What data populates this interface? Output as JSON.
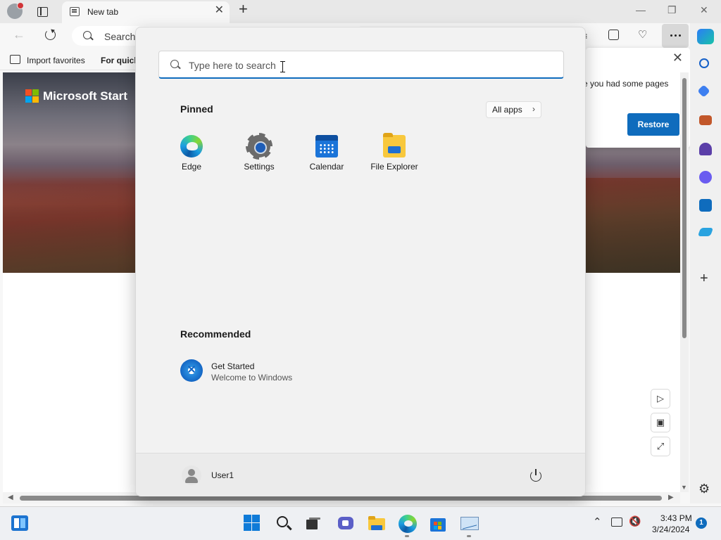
{
  "browser": {
    "tab_title": "New tab",
    "address_placeholder": "Search",
    "favorites": {
      "import_label": "Import favorites",
      "quick_label": "For quick"
    },
    "restore_prompt": {
      "text": "e you had some pages",
      "button_label": "Restore"
    },
    "brand": "Microsoft Start"
  },
  "start_menu": {
    "search_placeholder": "Type here to search",
    "pinned_title": "Pinned",
    "all_apps_label": "All apps",
    "pinned_apps": [
      {
        "label": "Edge",
        "icon": "edge-icon"
      },
      {
        "label": "Settings",
        "icon": "gear-icon"
      },
      {
        "label": "Calendar",
        "icon": "calendar-icon"
      },
      {
        "label": "File Explorer",
        "icon": "folder-icon"
      }
    ],
    "recommended_title": "Recommended",
    "recommended": [
      {
        "name": "Get Started",
        "subtitle": "Welcome to Windows",
        "icon": "get-started-icon"
      }
    ],
    "user_name": "User1"
  },
  "taskbar": {
    "time": "3:43 PM",
    "date": "3/24/2024",
    "notification_count": "1"
  },
  "colors": {
    "accent": "#0f6cbd",
    "windows_blue": "#0f7bd8"
  }
}
